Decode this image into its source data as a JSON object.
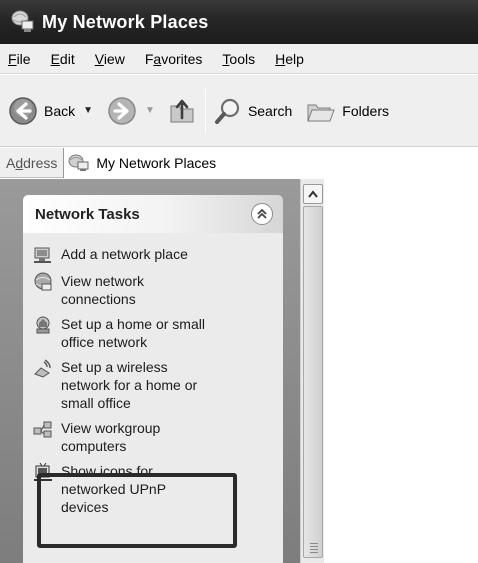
{
  "window": {
    "title": "My Network Places",
    "icon": "network-places-icon"
  },
  "menu": [
    {
      "accel": "F",
      "rest": "ile"
    },
    {
      "accel": "E",
      "rest": "dit"
    },
    {
      "accel": "V",
      "rest": "iew"
    },
    {
      "pre": "F",
      "accel": "a",
      "rest": "vorites"
    },
    {
      "accel": "T",
      "rest": "ools"
    },
    {
      "accel": "H",
      "rest": "elp"
    }
  ],
  "toolbar": {
    "back_label": "Back",
    "search_label": "Search",
    "folders_label": "Folders"
  },
  "address": {
    "label_pre": "A",
    "label_accel": "d",
    "label_rest": "dress",
    "value": "My Network Places"
  },
  "network_tasks": {
    "header": "Network Tasks",
    "items": [
      {
        "label": "Add a network place",
        "icon": "add-network-place-icon"
      },
      {
        "label": "View network\nconnections",
        "icon": "network-connections-icon"
      },
      {
        "label": "Set up a home or small\noffice network",
        "icon": "home-network-icon"
      },
      {
        "label": "Set up a wireless\nnetwork for a home or\nsmall office",
        "icon": "wireless-network-icon"
      },
      {
        "label": "View workgroup\ncomputers",
        "icon": "workgroup-icon"
      },
      {
        "label": "Show icons for\nnetworked UPnP\ndevices",
        "icon": "upnp-devices-icon"
      }
    ]
  }
}
